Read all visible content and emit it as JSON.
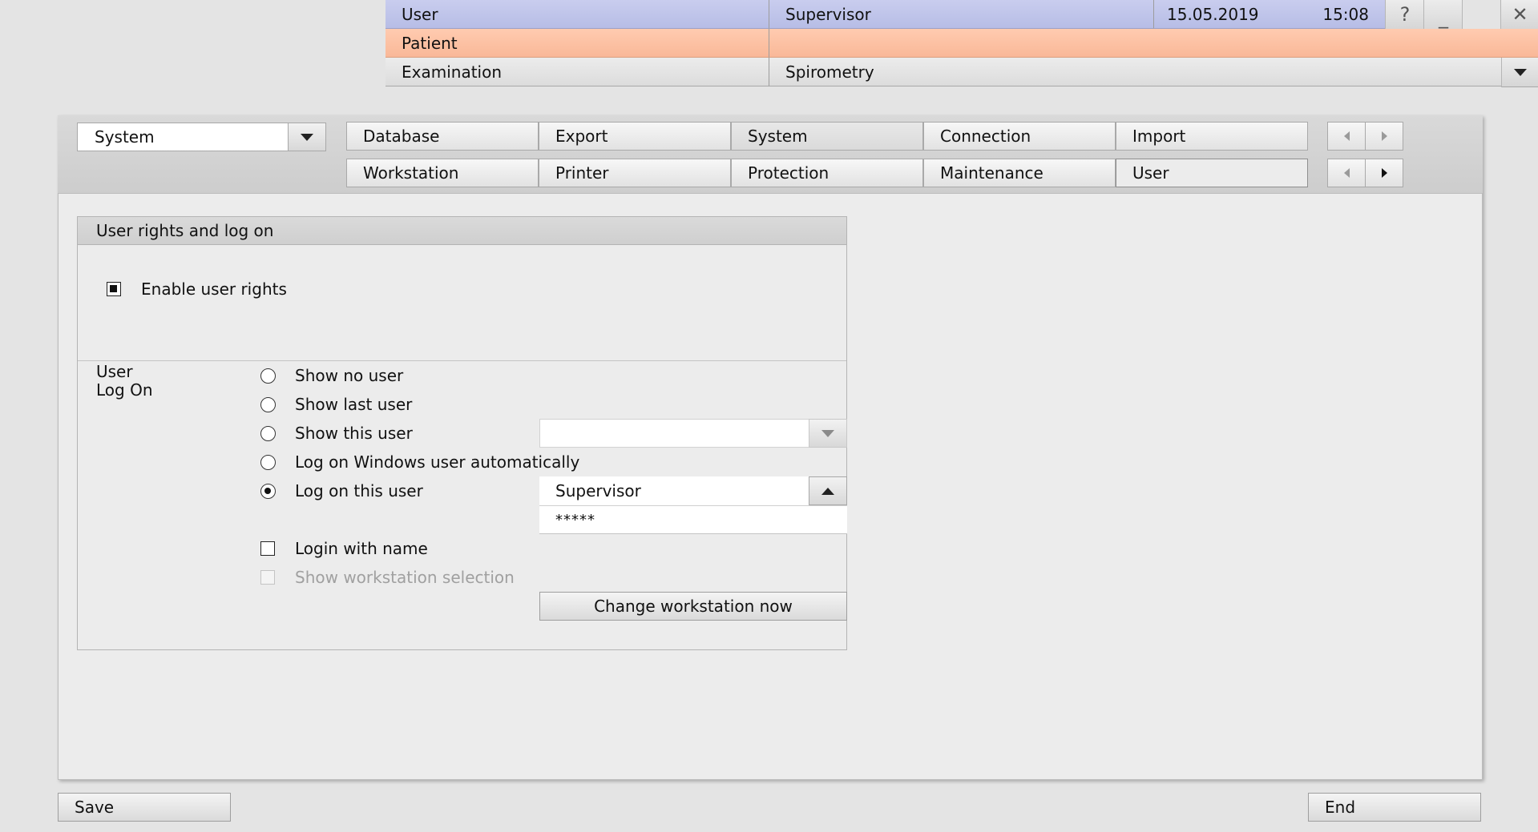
{
  "header": {
    "user_label": "User",
    "user_value": "Supervisor",
    "date": "15.05.2019",
    "time": "15:08",
    "help_symbol": "?",
    "minimize_symbol": "_",
    "close_symbol": "✕",
    "patient_label": "Patient",
    "patient_value": "",
    "examination_label": "Examination",
    "examination_value": "Spirometry"
  },
  "settings": {
    "category_select": "System",
    "tabs_row1": [
      "Database",
      "Export",
      "System",
      "Connection",
      "Import"
    ],
    "tabs_row2": [
      "Workstation",
      "Printer",
      "Protection",
      "Maintenance",
      "User"
    ],
    "active_tab": "User"
  },
  "group": {
    "title": "User rights and log on",
    "enable_user_rights": "Enable user rights",
    "logon_label_1": "User",
    "logon_label_2": "Log On",
    "options": [
      "Show no user",
      "Show last user",
      "Show this user",
      "Log on Windows user automatically",
      "Log on this user"
    ],
    "selected_option": "Log on this user",
    "show_this_user_value": "",
    "logon_user_value": "Supervisor",
    "password_value": "*****",
    "login_with_name": "Login with name",
    "show_workstation_selection": "Show workstation selection",
    "change_workstation_button": "Change workstation now"
  },
  "footer": {
    "save_label": "Save",
    "end_label": "End"
  },
  "colors": {
    "user_row": "#c0c5ea",
    "patient_row": "#fbc1a4",
    "background": "#e4e4e4"
  }
}
